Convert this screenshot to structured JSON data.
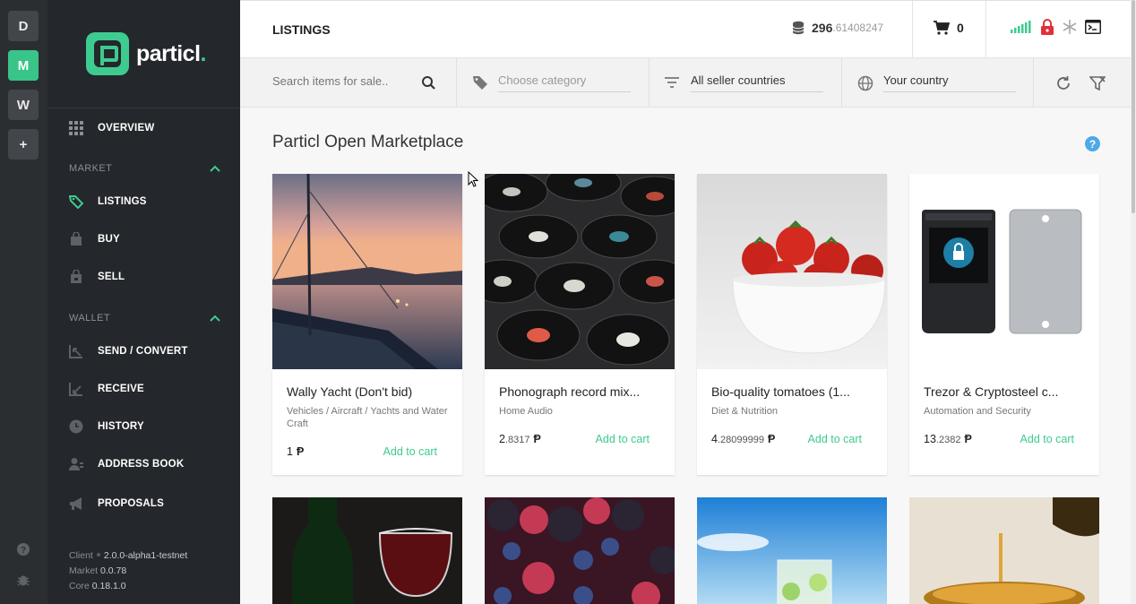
{
  "switcher": {
    "items": [
      {
        "label": "D"
      },
      {
        "label": "M"
      },
      {
        "label": "W"
      },
      {
        "label": "+"
      }
    ]
  },
  "logo": {
    "text": "particl",
    "dot": "."
  },
  "nav": {
    "overview": "OVERVIEW",
    "market_section": "MARKET",
    "listings": "LISTINGS",
    "buy": "BUY",
    "sell": "SELL",
    "wallet_section": "WALLET",
    "send_convert": "SEND / CONVERT",
    "receive": "RECEIVE",
    "history": "HISTORY",
    "address_book": "ADDRESS BOOK",
    "proposals": "PROPOSALS"
  },
  "client_info": {
    "client_label": "Client",
    "client_version": "2.0.0-alpha1-testnet",
    "market_label": "Market",
    "market_version": "0.0.78",
    "core_label": "Core",
    "core_version": "0.18.1.0"
  },
  "header": {
    "title": "LISTINGS",
    "balance_int": "296",
    "balance_dec": ".61408247",
    "cart_count": "0"
  },
  "filters": {
    "search_placeholder": "Search items for sale..",
    "category_placeholder": "Choose category",
    "seller_countries": "All seller countries",
    "your_country": "Your country"
  },
  "main": {
    "title": "Particl Open Marketplace",
    "help": "?"
  },
  "listings": [
    {
      "title": "Wally Yacht (Don't bid)",
      "category": "Vehicles / Aircraft / Yachts and Water Craft",
      "price_int": "1",
      "price_dec": "",
      "currency": "Ᵽ",
      "add_label": "Add to cart"
    },
    {
      "title": "Phonograph record mix...",
      "category": "Home Audio",
      "price_int": "2",
      "price_dec": ".8317",
      "currency": "Ᵽ",
      "add_label": "Add to cart"
    },
    {
      "title": "Bio-quality tomatoes (1...",
      "category": "Diet & Nutrition",
      "price_int": "4",
      "price_dec": ".28099999",
      "currency": "Ᵽ",
      "add_label": "Add to cart"
    },
    {
      "title": "Trezor & Cryptosteel c...",
      "category": "Automation and Security",
      "price_int": "13",
      "price_dec": ".2382",
      "currency": "Ᵽ",
      "add_label": "Add to cart"
    }
  ],
  "colors": {
    "accent": "#3ecb8f",
    "sidebar_bg": "#24272b",
    "switcher_bg": "#2b2e31",
    "help_blue": "#4ea9e6",
    "lock_red": "#e0303a"
  }
}
